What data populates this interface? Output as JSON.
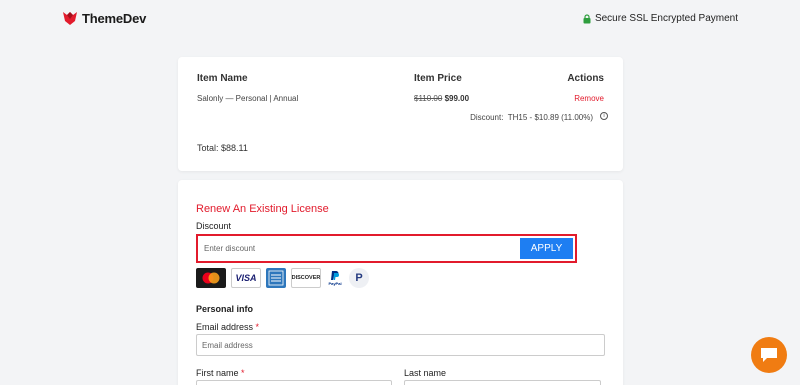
{
  "header": {
    "logo_text": "ThemeDev",
    "ssl_text": "Secure SSL Encrypted Payment",
    "brand_color": "#e21b2c"
  },
  "order": {
    "columns": [
      "Item Name",
      "Item Price",
      "Actions"
    ],
    "item": {
      "name": "Salonly — Personal | Annual",
      "old_price": "$110.00",
      "new_price": "$99.00",
      "action": "Remove"
    },
    "discount_label": "Discount:",
    "discount_value": "TH15 - $10.89 (11.00%)",
    "total": "Total: $88.11"
  },
  "checkout": {
    "renew_link": "Renew An Existing License",
    "discount_label": "Discount",
    "discount_placeholder": "Enter discount",
    "apply_label": "APPLY",
    "payment_icons": [
      "mastercard-icon",
      "visa-icon",
      "amex-icon",
      "discover-icon",
      "paypal-icon",
      "paypal-p-icon"
    ],
    "payment_labels": {
      "visa": "VISA",
      "discover": "DISCOVER",
      "paypal": "PayPal",
      "paypal_p": "P",
      "amex": "AMEX"
    },
    "personal_info_title": "Personal info",
    "email_label": "Email address",
    "email_placeholder": "Email address",
    "first_name_label": "First name",
    "last_name_label": "Last name",
    "required_mark": "*"
  },
  "colors": {
    "accent_red": "#e21b2c",
    "apply_blue": "#1e7ef2",
    "chat_orange": "#f07c12"
  }
}
